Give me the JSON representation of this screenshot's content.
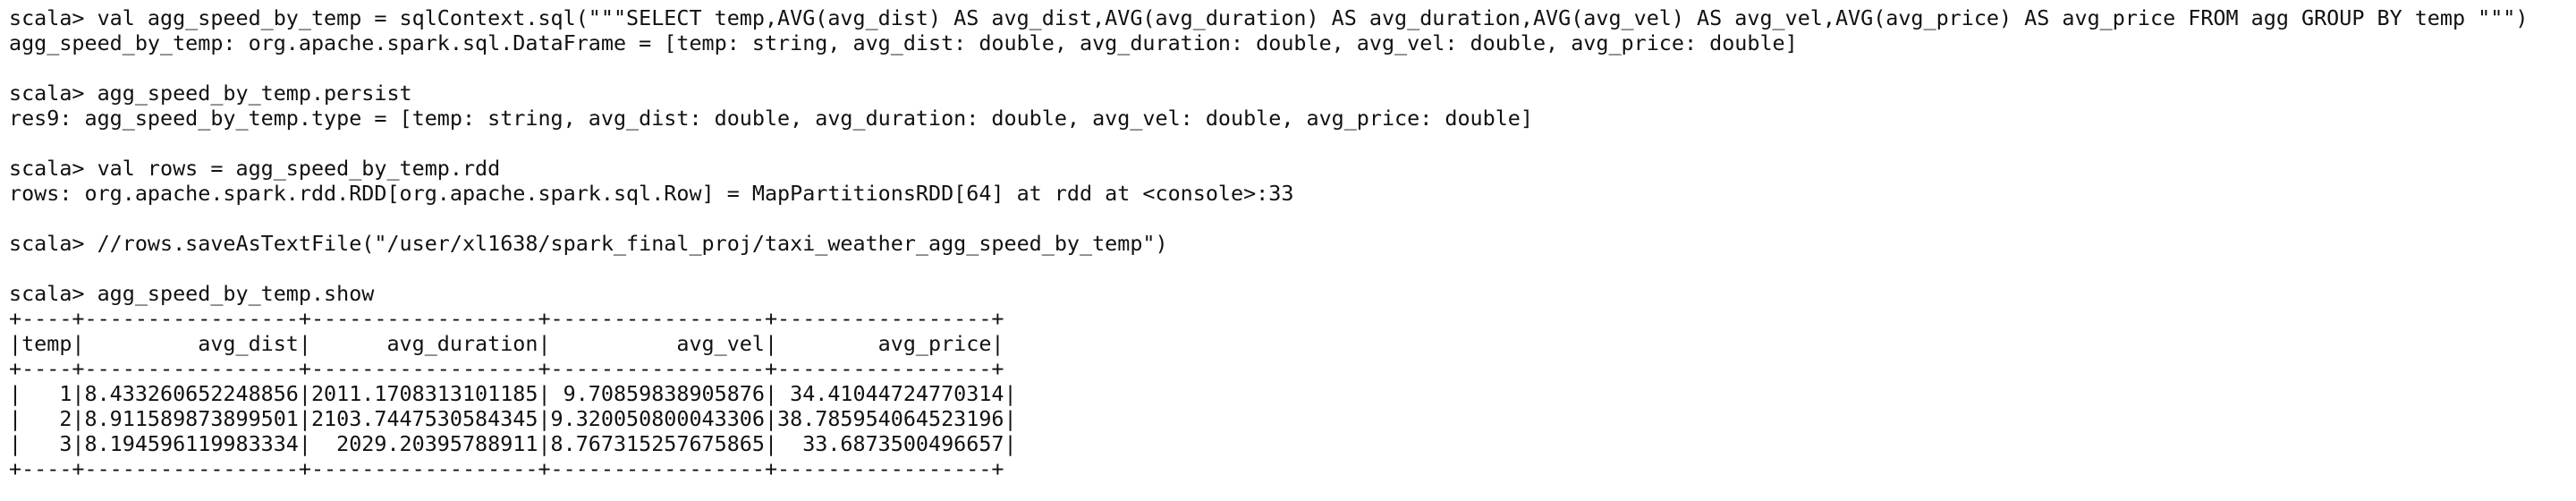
{
  "terminal": {
    "lines": [
      "scala> val agg_speed_by_temp = sqlContext.sql(\"\"\"SELECT temp,AVG(avg_dist) AS avg_dist,AVG(avg_duration) AS avg_duration,AVG(avg_vel) AS avg_vel,AVG(avg_price) AS avg_price FROM agg GROUP BY temp \"\"\")",
      "agg_speed_by_temp: org.apache.spark.sql.DataFrame = [temp: string, avg_dist: double, avg_duration: double, avg_vel: double, avg_price: double]",
      "",
      "scala> agg_speed_by_temp.persist",
      "res9: agg_speed_by_temp.type = [temp: string, avg_dist: double, avg_duration: double, avg_vel: double, avg_price: double]",
      "",
      "scala> val rows = agg_speed_by_temp.rdd",
      "rows: org.apache.spark.rdd.RDD[org.apache.spark.sql.Row] = MapPartitionsRDD[64] at rdd at <console>:33",
      "",
      "scala> //rows.saveAsTextFile(\"/user/xl1638/spark_final_proj/taxi_weather_agg_speed_by_temp\")",
      "",
      "scala> agg_speed_by_temp.show",
      "+----+-----------------+------------------+-----------------+-----------------+",
      "|temp|         avg_dist|      avg_duration|          avg_vel|        avg_price|",
      "+----+-----------------+------------------+-----------------+-----------------+",
      "|   1|8.433260652248856|2011.1708313101185| 9.70859838905876| 34.41044724770314|",
      "|   2|8.911589873899501|2103.7447530584345|9.320050800043306|38.785954064523196|",
      "|   3|8.194596119983334|  2029.20395788911|8.767315257675865|  33.6873500496657|",
      "+----+-----------------+------------------+-----------------+-----------------+"
    ]
  }
}
